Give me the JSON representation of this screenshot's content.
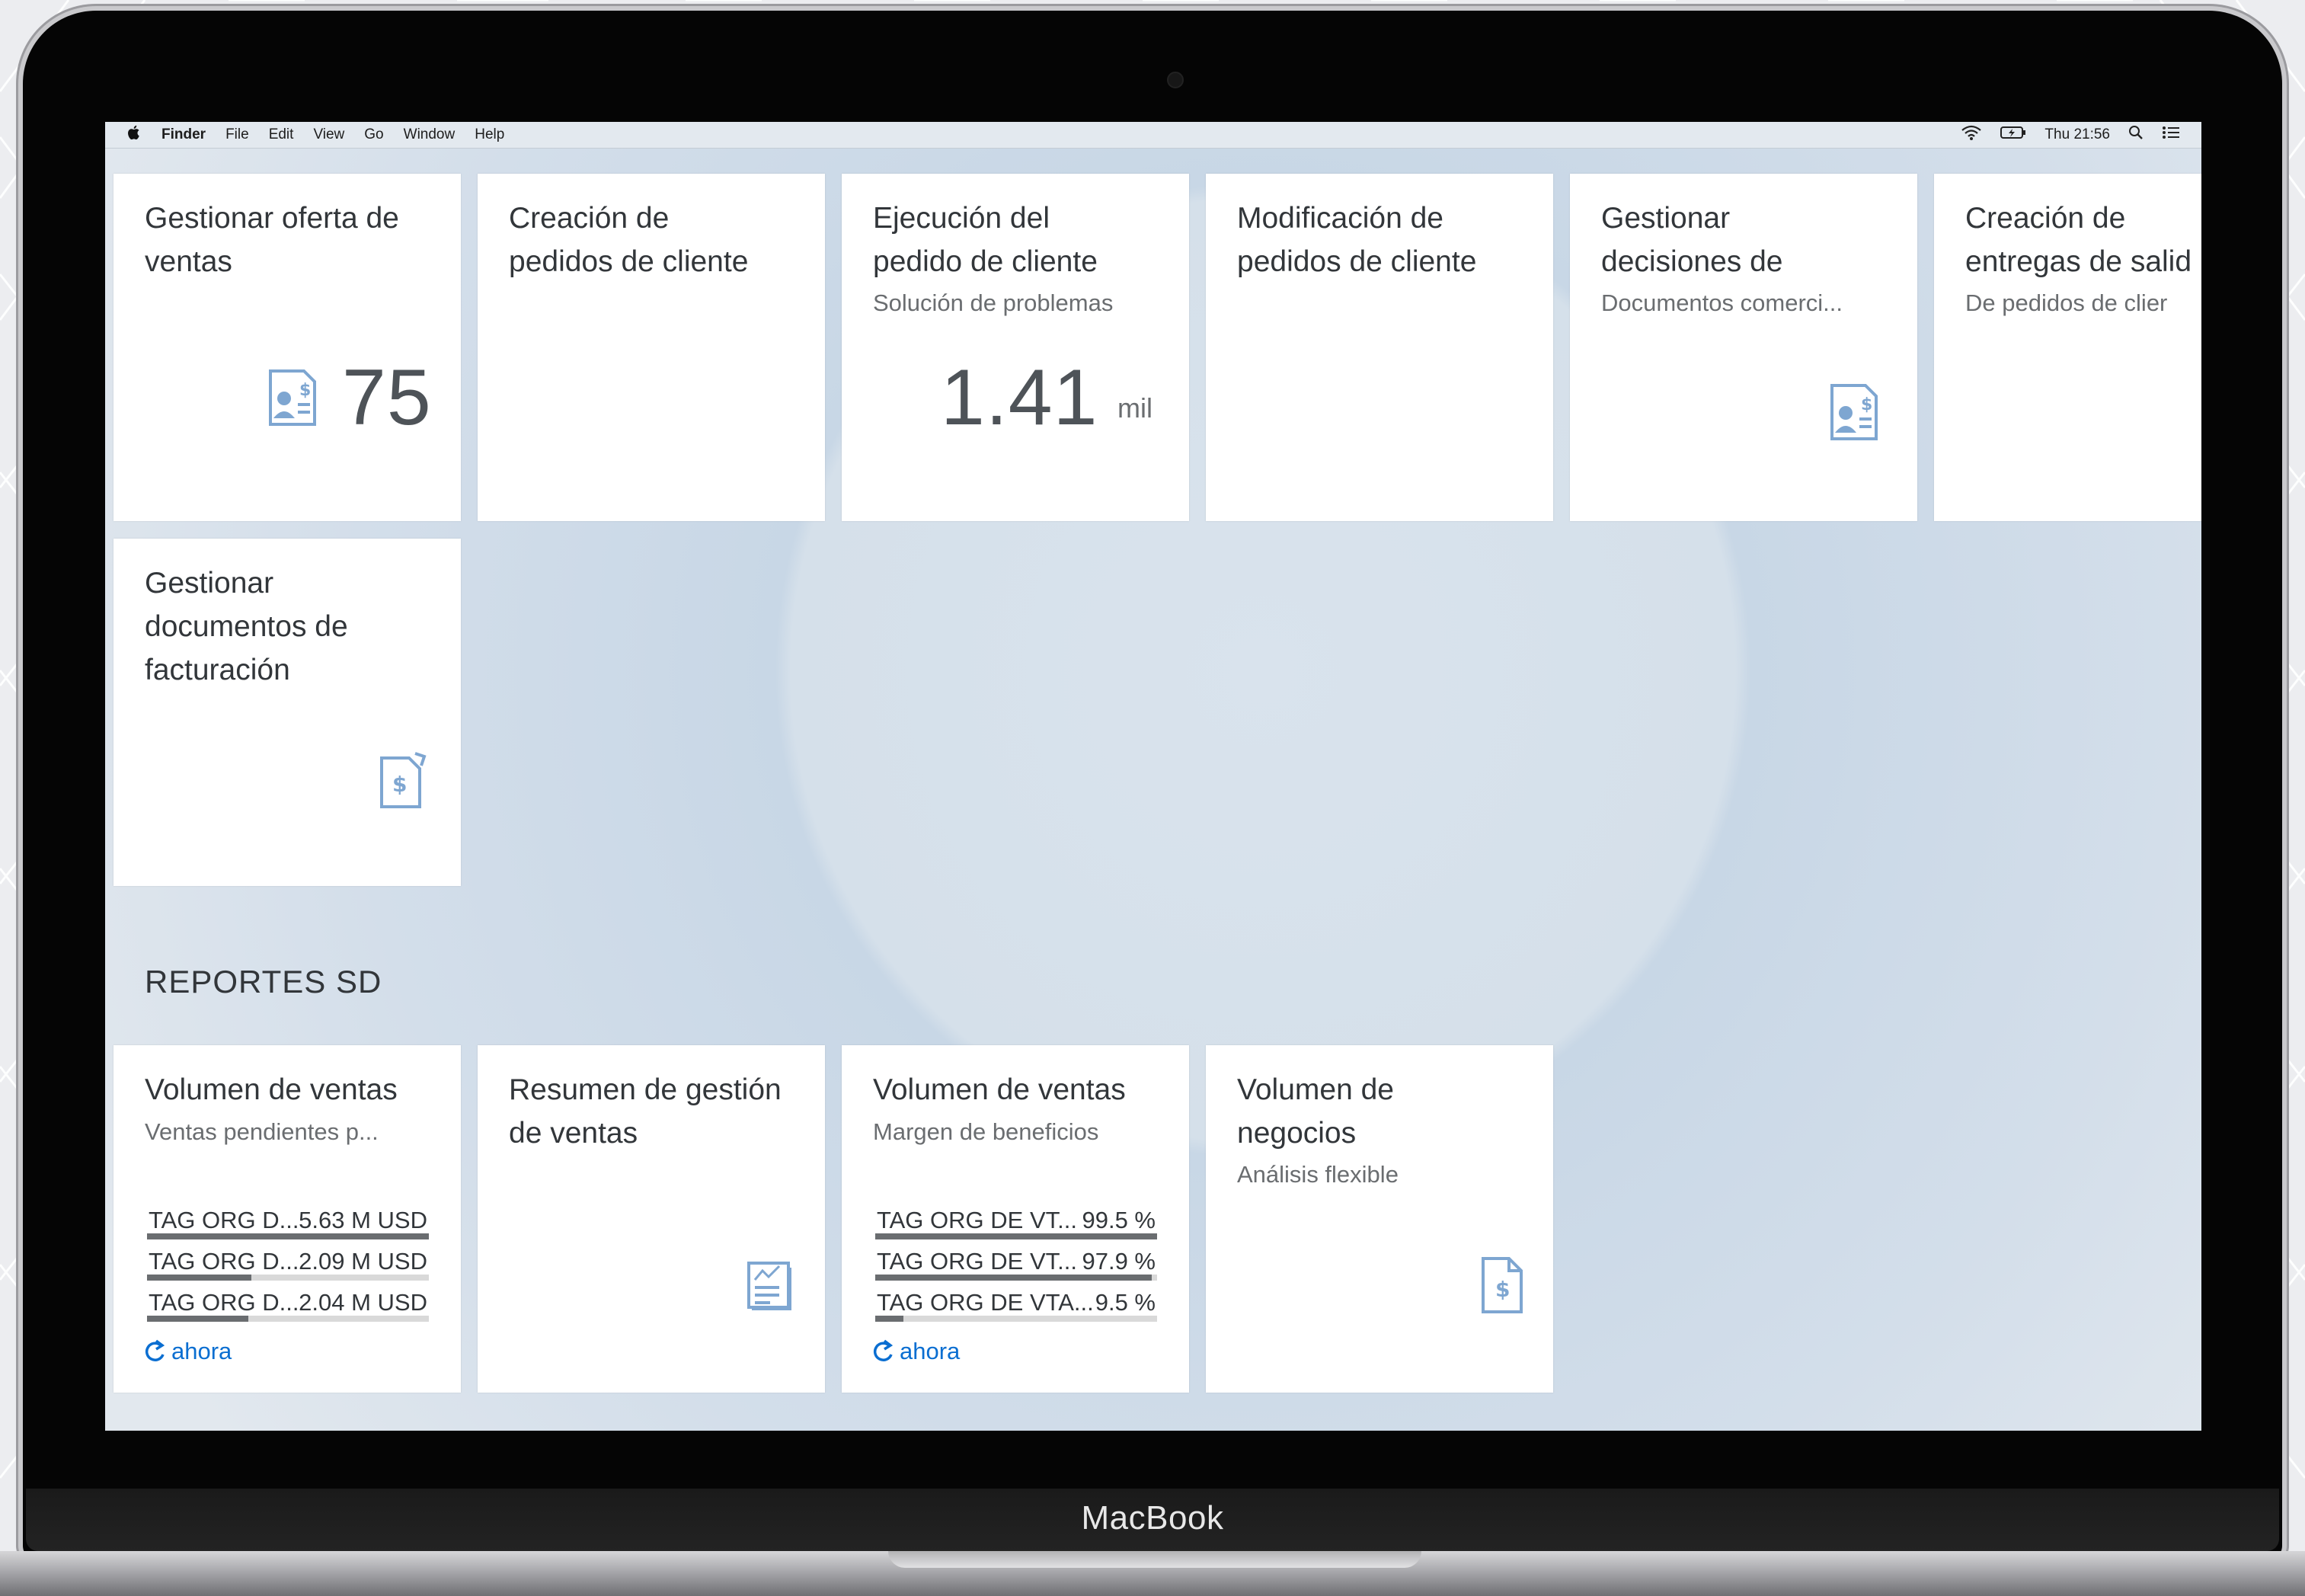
{
  "menubar": {
    "apple": "",
    "app_name": "Finder",
    "menus": [
      "File",
      "Edit",
      "View",
      "Go",
      "Window",
      "Help"
    ],
    "clock": "Thu 21:56"
  },
  "tiles": {
    "t1": {
      "title": "Gestionar oferta de\nventas",
      "kpi": "75"
    },
    "t2": {
      "title": "Creación de\npedidos de cliente"
    },
    "t3": {
      "title": "Ejecución del\npedido de cliente",
      "subtitle": "Solución de problemas",
      "kpi": "1.41",
      "unit": "mil"
    },
    "t4": {
      "title": "Modificación de\npedidos de cliente"
    },
    "t5": {
      "title": "Gestionar\ndecisiones de",
      "subtitle": "Documentos comerci..."
    },
    "t6": {
      "title": "Creación de\nentregas de salid",
      "subtitle": "De pedidos de clier"
    },
    "t7": {
      "title": "Gestionar\ndocumentos de\nfacturación"
    }
  },
  "section": {
    "title": "REPORTES SD"
  },
  "reports": {
    "r1": {
      "title": "Volumen de ventas",
      "subtitle": "Ventas pendientes p...",
      "rows": [
        {
          "label": "TAG ORG D...",
          "value": "5.63 M USD",
          "fraction": 1.0
        },
        {
          "label": "TAG ORG D...",
          "value": "2.09 M USD",
          "fraction": 0.37
        },
        {
          "label": "TAG ORG D...",
          "value": "2.04 M USD",
          "fraction": 0.36
        }
      ],
      "refresh": "ahora"
    },
    "r2": {
      "title": "Resumen de gestión\nde ventas"
    },
    "r3": {
      "title": "Volumen de ventas",
      "subtitle": "Margen de beneficios",
      "rows": [
        {
          "label": "TAG ORG DE VT...",
          "value": "99.5 %",
          "fraction": 1.0
        },
        {
          "label": "TAG ORG DE VT...",
          "value": "97.9 %",
          "fraction": 0.98
        },
        {
          "label": "TAG ORG DE VTA...",
          "value": "9.5 %",
          "fraction": 0.1
        }
      ],
      "refresh": "ahora"
    },
    "r4": {
      "title": "Volumen de\nnegocios",
      "subtitle": "Análisis flexible"
    }
  },
  "laptop": {
    "brand": "MacBook"
  },
  "colors": {
    "tile_bg": "#ffffff",
    "accent": "#0a6ed1",
    "icon": "#7ea6d1",
    "text": "#32363a"
  }
}
